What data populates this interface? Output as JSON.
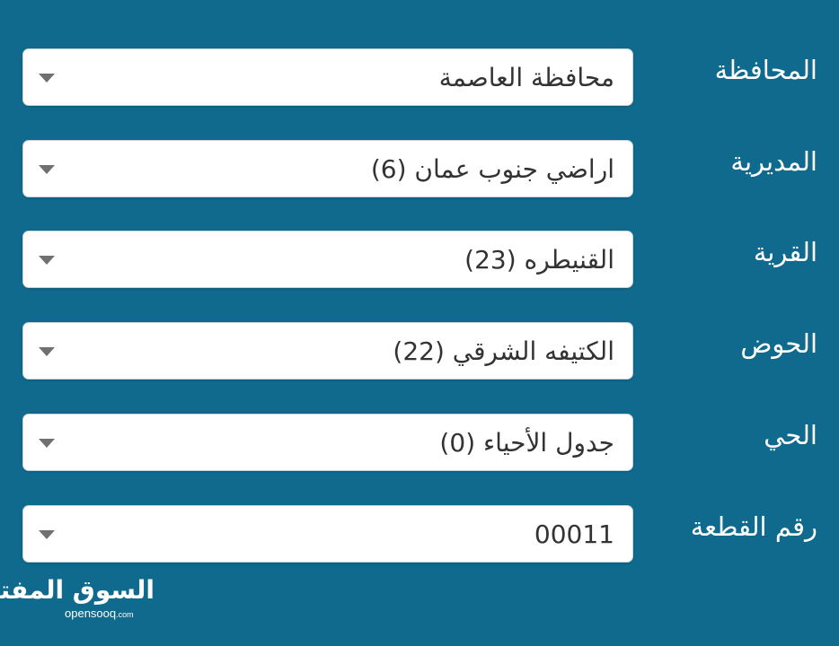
{
  "fields": [
    {
      "label": "المحافظة",
      "value": "محافظة العاصمة"
    },
    {
      "label": "المديرية",
      "value": "اراضي جنوب عمان (6)"
    },
    {
      "label": "القرية",
      "value": "القنيطره (23)"
    },
    {
      "label": "الحوض",
      "value": "الكتيفه الشرقي (22)"
    },
    {
      "label": "الحي",
      "value": "جدول الأحياء (0)"
    },
    {
      "label": "رقم القطعة",
      "value": "00011"
    }
  ],
  "logo": {
    "arabic": "السوق المفتوح",
    "english": "opensooq",
    "english_suffix": ".com"
  },
  "colors": {
    "background": "#0f6a8e",
    "field_background": "#ffffff",
    "label_text": "#ffffff",
    "value_text": "#333333",
    "caret": "#707070"
  },
  "icons": {
    "dropdown": "chevron-down-icon"
  }
}
